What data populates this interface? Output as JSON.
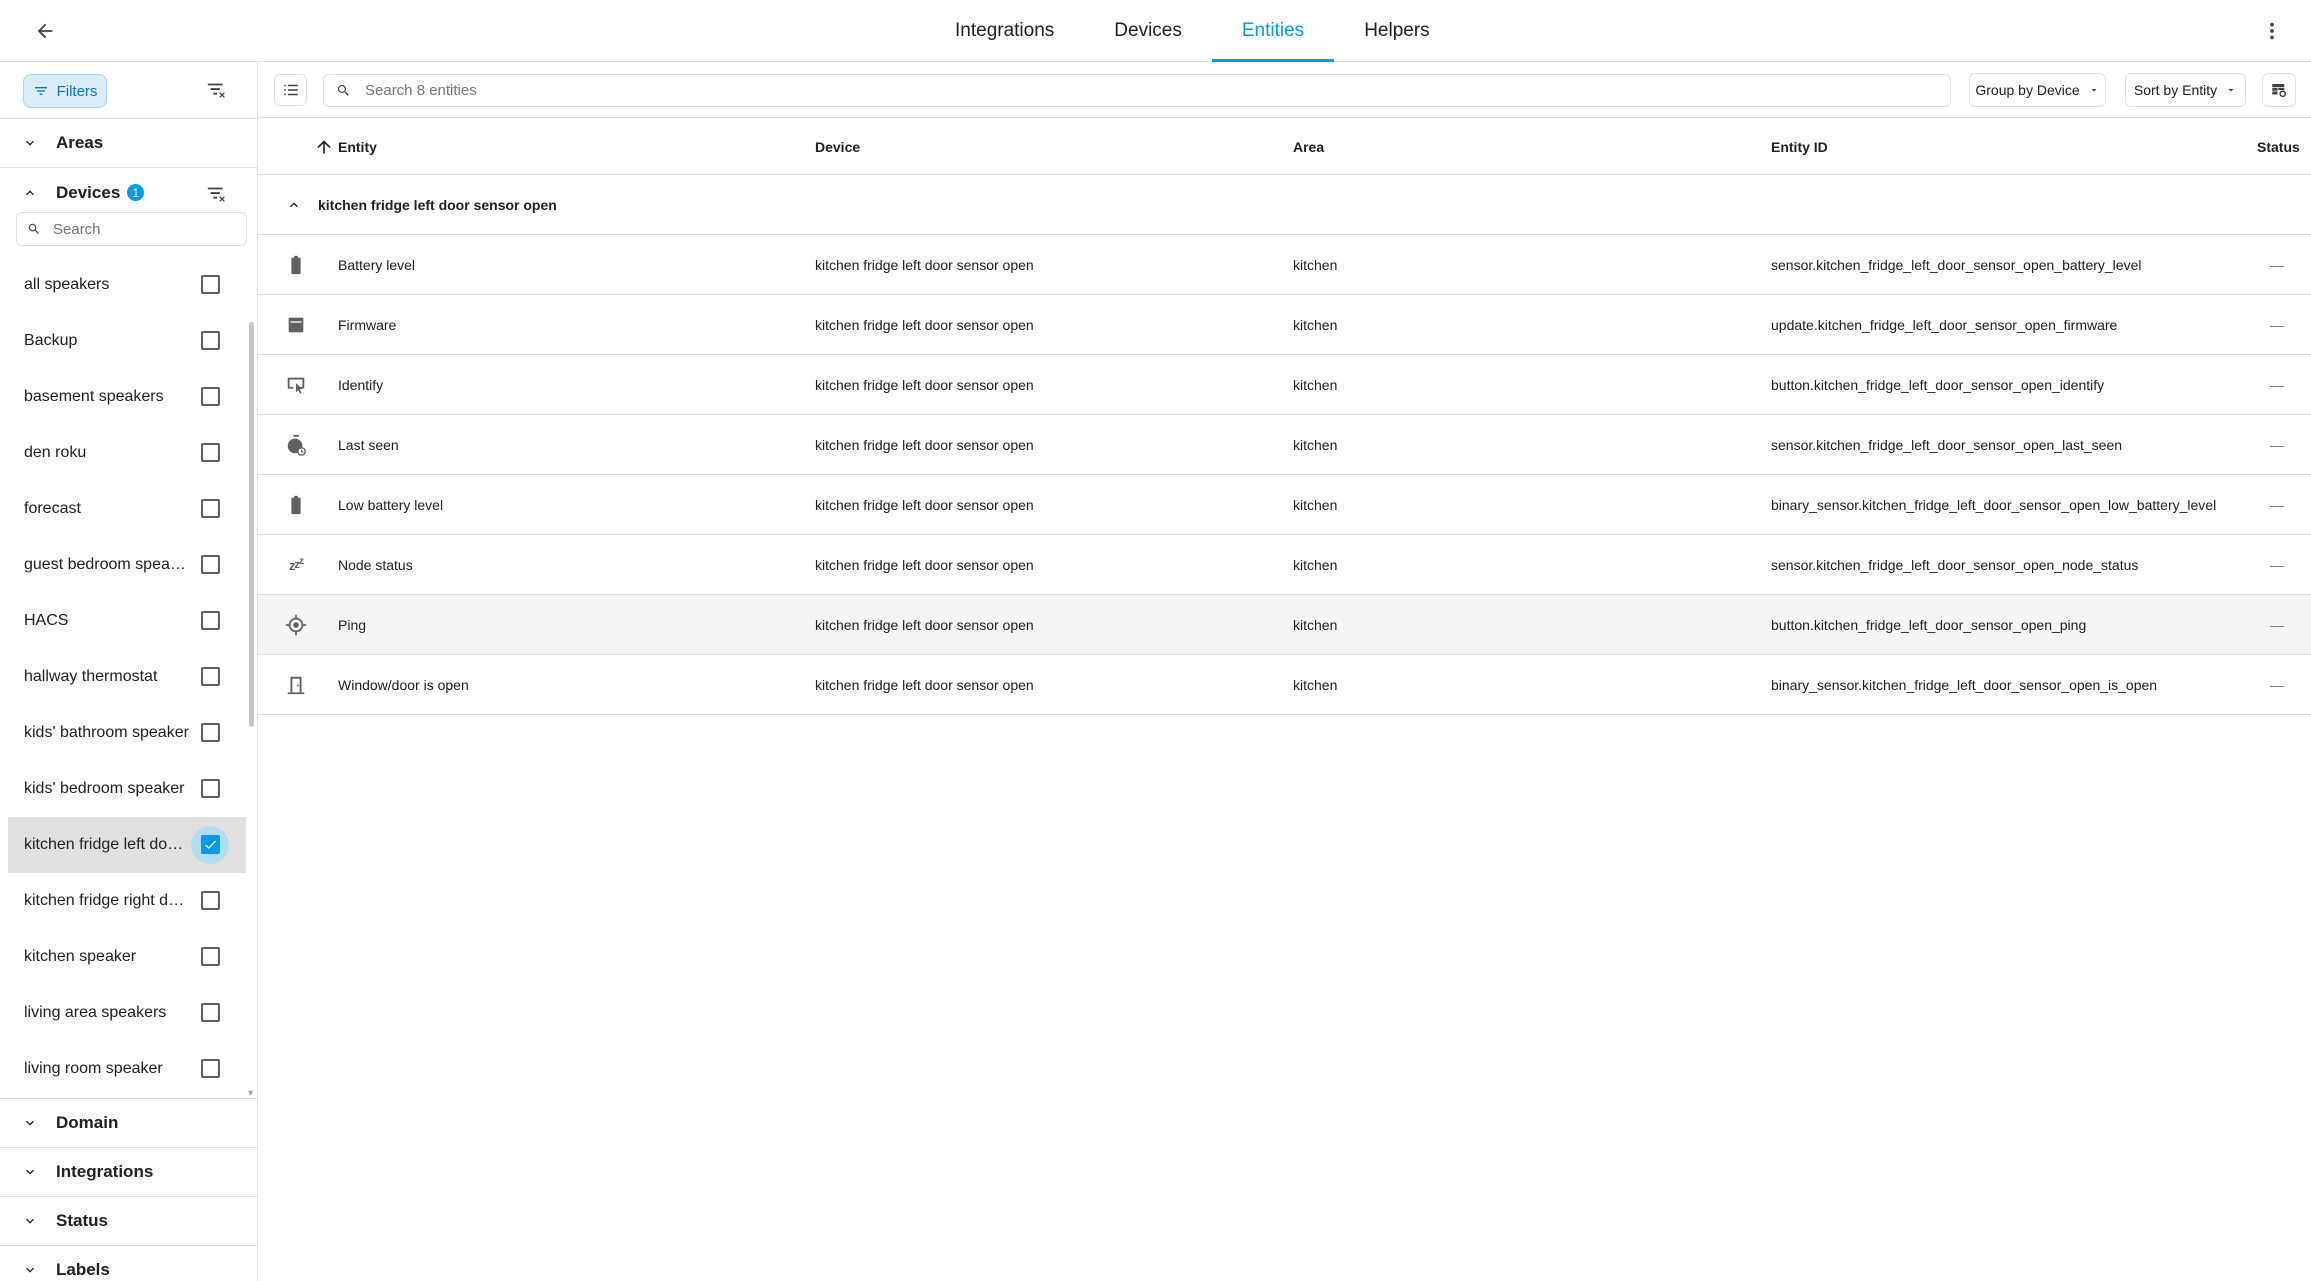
{
  "topbar": {
    "tabs": [
      {
        "label": "Integrations",
        "active": false
      },
      {
        "label": "Devices",
        "active": false
      },
      {
        "label": "Entities",
        "active": true
      },
      {
        "label": "Helpers",
        "active": false
      }
    ]
  },
  "sidebar": {
    "filters_label": "Filters",
    "sections": {
      "areas": "Areas",
      "devices": "Devices",
      "devices_badge": "1",
      "domain": "Domain",
      "integrations": "Integrations",
      "status": "Status",
      "labels": "Labels"
    },
    "device_search_placeholder": "Search",
    "devices": [
      {
        "name": "all speakers",
        "checked": false
      },
      {
        "name": "Backup",
        "checked": false
      },
      {
        "name": "basement speakers",
        "checked": false
      },
      {
        "name": "den roku",
        "checked": false
      },
      {
        "name": "forecast",
        "checked": false
      },
      {
        "name": "guest bedroom speaker",
        "checked": false
      },
      {
        "name": "HACS",
        "checked": false
      },
      {
        "name": "hallway thermostat",
        "checked": false
      },
      {
        "name": "kids' bathroom speaker",
        "checked": false
      },
      {
        "name": "kids' bedroom speaker",
        "checked": false
      },
      {
        "name": "kitchen fridge left door s...",
        "checked": true
      },
      {
        "name": "kitchen fridge right door ...",
        "checked": false
      },
      {
        "name": "kitchen speaker",
        "checked": false
      },
      {
        "name": "living area speakers",
        "checked": false
      },
      {
        "name": "living room speaker",
        "checked": false
      }
    ]
  },
  "toolbar": {
    "search_placeholder": "Search 8 entities",
    "group_by": "Group by Device",
    "sort_by": "Sort by Entity"
  },
  "table": {
    "columns": {
      "entity": "Entity",
      "device": "Device",
      "area": "Area",
      "entity_id": "Entity ID",
      "status": "Status"
    },
    "group_name": "kitchen fridge left door sensor open",
    "rows": [
      {
        "icon": "battery-icon",
        "entity": "Battery level",
        "device": "kitchen fridge left door sensor open",
        "area": "kitchen",
        "entity_id": "sensor.kitchen_fridge_left_door_sensor_open_battery_level",
        "status": "—"
      },
      {
        "icon": "firmware-icon",
        "entity": "Firmware",
        "device": "kitchen fridge left door sensor open",
        "area": "kitchen",
        "entity_id": "update.kitchen_fridge_left_door_sensor_open_firmware",
        "status": "—"
      },
      {
        "icon": "identify-icon",
        "entity": "Identify",
        "device": "kitchen fridge left door sensor open",
        "area": "kitchen",
        "entity_id": "button.kitchen_fridge_left_door_sensor_open_identify",
        "status": "—"
      },
      {
        "icon": "timer-icon",
        "entity": "Last seen",
        "device": "kitchen fridge left door sensor open",
        "area": "kitchen",
        "entity_id": "sensor.kitchen_fridge_left_door_sensor_open_last_seen",
        "status": "—"
      },
      {
        "icon": "battery-icon",
        "entity": "Low battery level",
        "device": "kitchen fridge left door sensor open",
        "area": "kitchen",
        "entity_id": "binary_sensor.kitchen_fridge_left_door_sensor_open_low_battery_level",
        "status": "—"
      },
      {
        "icon": "sleep-icon",
        "entity": "Node status",
        "device": "kitchen fridge left door sensor open",
        "area": "kitchen",
        "entity_id": "sensor.kitchen_fridge_left_door_sensor_open_node_status",
        "status": "—"
      },
      {
        "icon": "crosshairs-icon",
        "entity": "Ping",
        "device": "kitchen fridge left door sensor open",
        "area": "kitchen",
        "entity_id": "button.kitchen_fridge_left_door_sensor_open_ping",
        "status": "—"
      },
      {
        "icon": "door-open-icon",
        "entity": "Window/door is open",
        "device": "kitchen fridge left door sensor open",
        "area": "kitchen",
        "entity_id": "binary_sensor.kitchen_fridge_left_door_sensor_open_is_open",
        "status": "—"
      }
    ]
  }
}
